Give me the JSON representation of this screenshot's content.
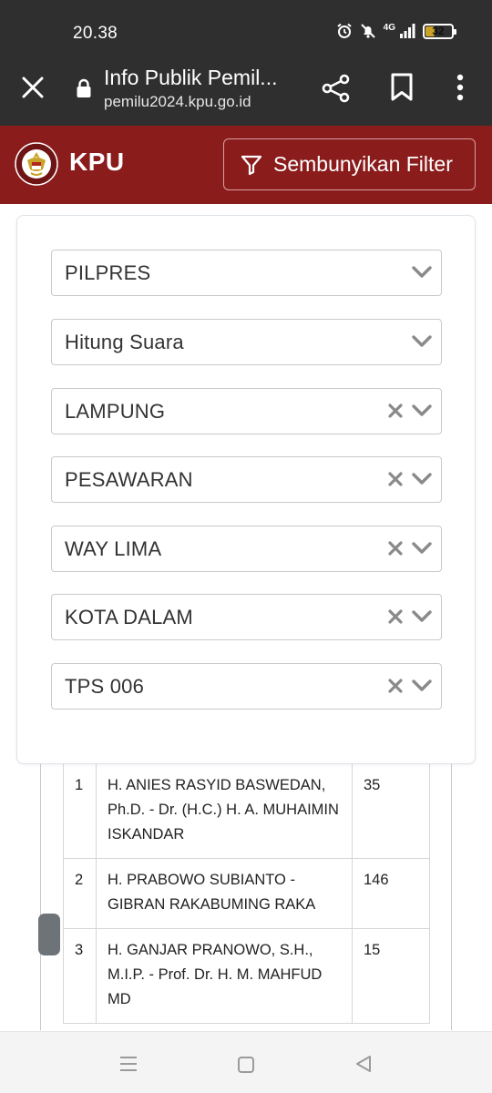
{
  "status_bar": {
    "time": "20.38",
    "network": "4G",
    "battery": "32",
    "battery_level": 0.32
  },
  "browser": {
    "title": "Info Publik Pemil...",
    "url": "pemilu2024.kpu.go.id"
  },
  "header": {
    "brand": "KPU",
    "filter_button": "Sembunyikan Filter"
  },
  "filters": [
    {
      "value": "PILPRES",
      "clearable": false
    },
    {
      "value": "Hitung Suara",
      "clearable": false
    },
    {
      "value": "LAMPUNG",
      "clearable": true
    },
    {
      "value": "PESAWARAN",
      "clearable": true
    },
    {
      "value": "WAY LIMA",
      "clearable": true
    },
    {
      "value": "KOTA DALAM",
      "clearable": true
    },
    {
      "value": "TPS 006",
      "clearable": true
    }
  ],
  "results": [
    {
      "no": "1",
      "candidate": "H. ANIES RASYID BASWEDAN, Ph.D. - Dr. (H.C.) H. A. MUHAIMIN ISKANDAR",
      "votes": "35"
    },
    {
      "no": "2",
      "candidate": "H. PRABOWO SUBIANTO - GIBRAN RAKABUMING RAKA",
      "votes": "146"
    },
    {
      "no": "3",
      "candidate": "H. GANJAR PRANOWO, S.H., M.I.P. - Prof. Dr. H. M. MAHFUD MD",
      "votes": "15"
    }
  ],
  "colors": {
    "header_red": "#8b1c1c",
    "browser_dark": "#2f2f30",
    "chevron_gray": "#8a8a8a"
  },
  "icons": {
    "close": "close-icon",
    "lock": "lock-icon",
    "share": "share-icon",
    "bookmark": "bookmark-icon",
    "menu": "more-vert-icon",
    "filter": "filter-icon",
    "clear": "clear-icon",
    "chevron": "chevron-down-icon"
  }
}
